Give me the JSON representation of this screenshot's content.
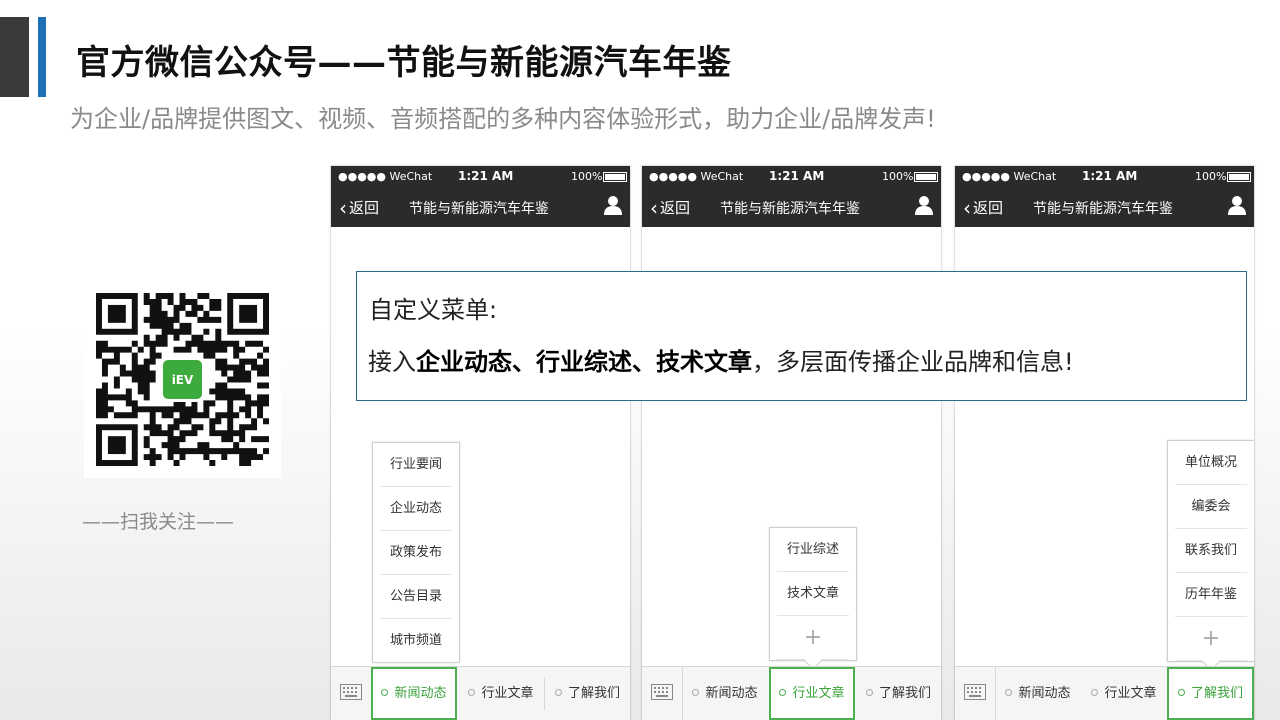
{
  "slide": {
    "title": "官方微信公众号——节能与新能源汽车年鉴",
    "subtitle": "为企业/品牌提供图文、视频、音频搭配的多种内容体验形式，助力企业/品牌发声!",
    "accent_color": "#1f6fb5",
    "qr_caption": "——扫我关注——"
  },
  "qr": {
    "logo_text": "iEV"
  },
  "phone_common": {
    "carrier": "●●●●● WeChat",
    "time": "1:21 AM",
    "battery": "100%",
    "back_label": "返回",
    "nav_title": "节能与新能源汽车年鉴"
  },
  "tabs": [
    "新闻动态",
    "行业文章",
    "了解我们"
  ],
  "phones": [
    {
      "active_tab": "新闻动态",
      "submenu": [
        "行业要闻",
        "企业动态",
        "政策发布",
        "公告目录",
        "城市频道"
      ]
    },
    {
      "active_tab": "行业文章",
      "submenu": [
        "行业综述",
        "技术文章",
        "+"
      ]
    },
    {
      "active_tab": "了解我们",
      "submenu": [
        "单位概况",
        "编委会",
        "联系我们",
        "历年年鉴",
        "+"
      ]
    }
  ],
  "callout": {
    "heading": "自定义菜单:",
    "body_prefix": "接入",
    "body_bold": "企业动态、行业综述、技术文章",
    "body_suffix": "，多层面传播企业品牌和信息!"
  },
  "colors": {
    "nav_bg": "#2b2b2b",
    "active_tab": "#4caf50",
    "callout_border": "#2a6c8a"
  }
}
